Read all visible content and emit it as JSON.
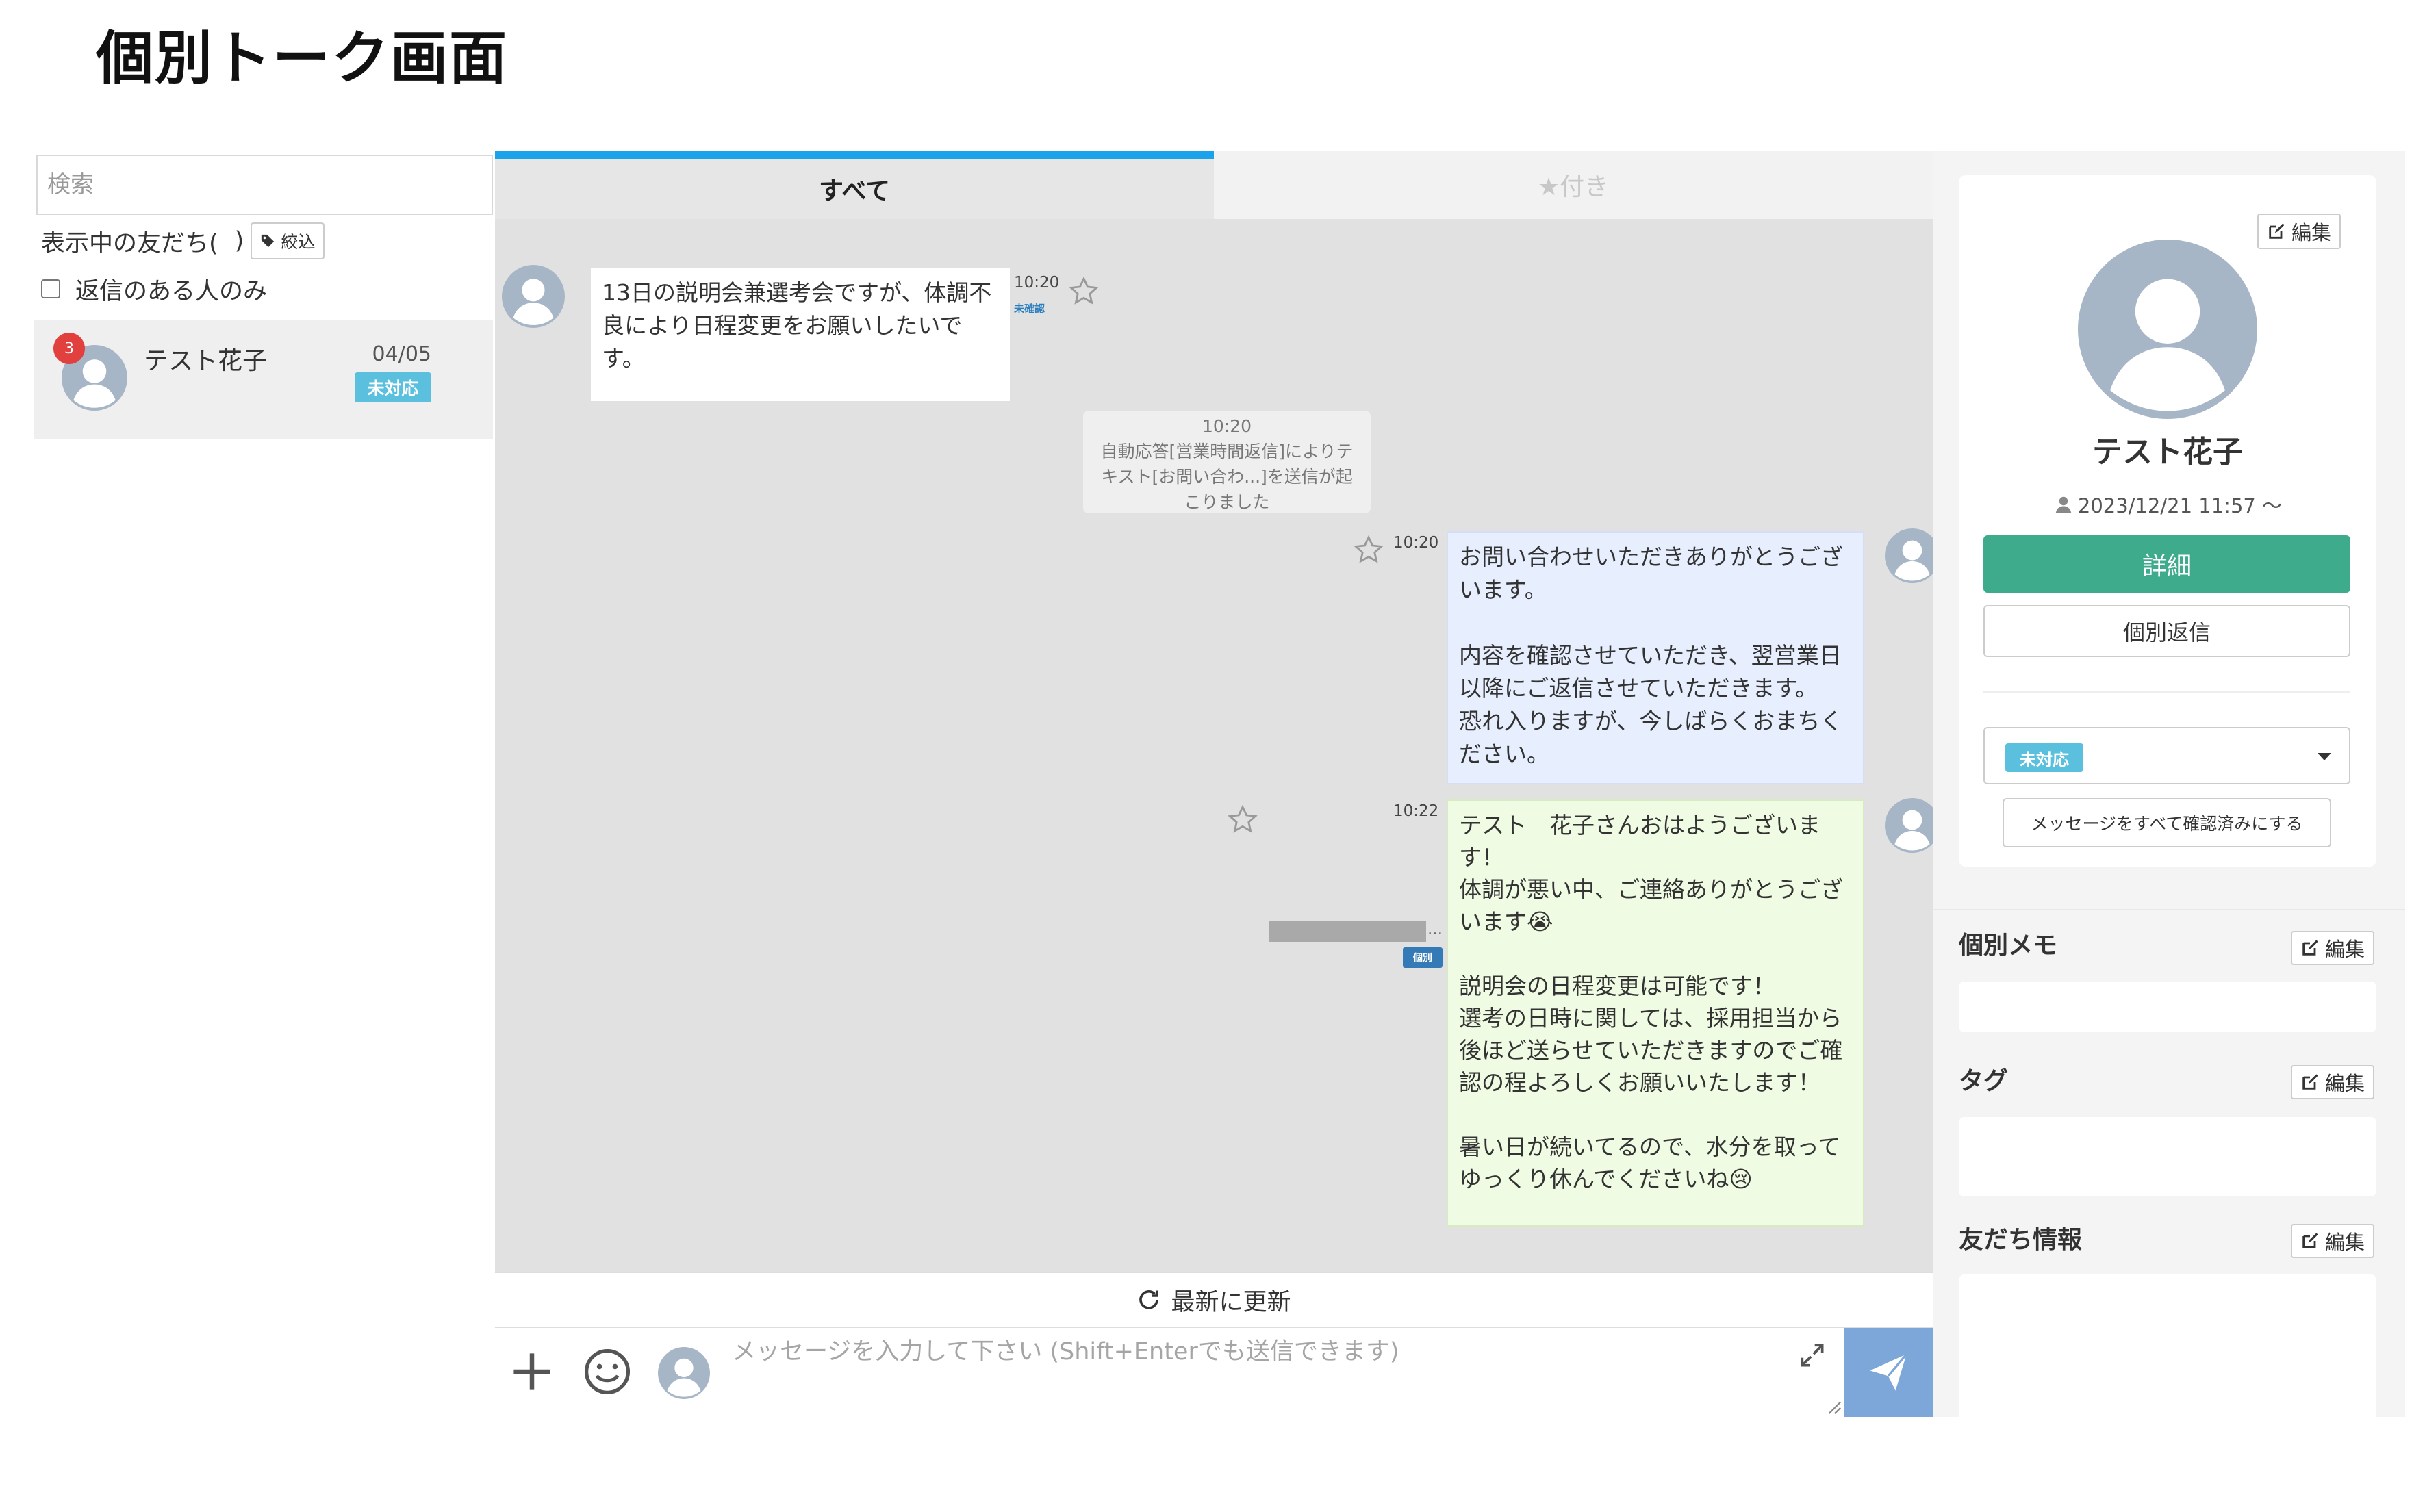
{
  "page_title": "個別トーク画面",
  "left": {
    "search_placeholder": "検索",
    "friends_showing_label": "表示中の友だち(",
    "friends_showing_close": ")",
    "filter_button": "絞込",
    "reply_only_label": "返信のある人のみ",
    "friends": [
      {
        "name": "テスト花子",
        "date": "04/05",
        "unread_count": "3",
        "status": "未対応"
      }
    ]
  },
  "tabs": {
    "all": "すべて",
    "starred": "★付き"
  },
  "messages": [
    {
      "direction": "in",
      "text": "13日の説明会兼選考会ですが、体調不良により日程変更をお願いしたいです。",
      "time": "10:20",
      "read_status": "未確認"
    },
    {
      "type": "system",
      "time": "10:20",
      "text": "自動応答[営業時間返信]によりテキスト[お問い合わ...]を送信が起こりました"
    },
    {
      "direction": "out",
      "time": "10:20",
      "lines": [
        "お問い合わせいただきありがとうございます。",
        "",
        "内容を確認させていただき、翌営業日以降にご返信させていただきます。",
        "恐れ入りますが、今しばらくおまちください。"
      ]
    },
    {
      "direction": "out",
      "time": "10:22",
      "sender_badge": "個別",
      "ellipsis": "…",
      "lines": [
        "テスト　花子さんおはようございます！",
        "体調が悪い中、ご連絡ありがとうございます😭",
        "",
        "説明会の日程変更は可能です！",
        "選考の日時に関しては、採用担当から後ほど送らせていただきますのでご確認の程よろしくお願いいたします！",
        "",
        "暑い日が続いてるので、水分を取ってゆっくり休んでくださいね😢"
      ]
    }
  ],
  "chat": {
    "refresh_label": "最新に更新",
    "input_placeholder": "メッセージを入力して下さい (Shift+Enterでも送信できます)"
  },
  "profile": {
    "edit_label": "編集",
    "name": "テスト花子",
    "since": "2023/12/21 11:57 〜",
    "detail_button": "詳細",
    "reply_button": "個別返信",
    "status": "未対応",
    "confirm_all_button": "メッセージをすべて確認済みにする"
  },
  "sections": [
    {
      "title": "個別メモ",
      "edit_label": "編集"
    },
    {
      "title": "タグ",
      "edit_label": "編集"
    },
    {
      "title": "友だち情報",
      "edit_label": "編集"
    }
  ],
  "colors": {
    "accent_blue": "#1aa3ea",
    "detail_green": "#3fab8d",
    "status_cyan": "#5bc0de",
    "send_blue": "#7da7d9",
    "badge_red": "#e2403f"
  }
}
